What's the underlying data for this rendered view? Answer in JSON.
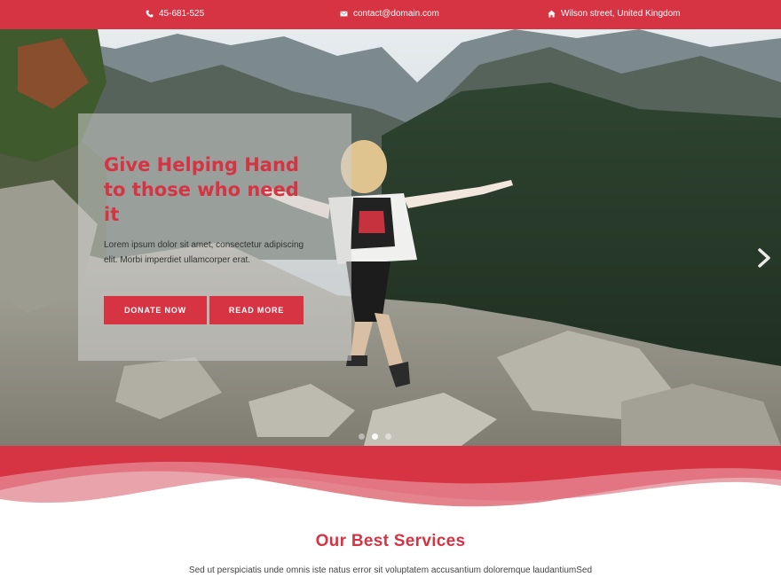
{
  "topbar": {
    "phone": "45-681-525",
    "email": "contact@domain.com",
    "address": "Wilson street, United Kingdom"
  },
  "hero": {
    "title": "Give Helping Hand to those who need it",
    "text": "Lorem ipsum dolor sit amet, consectetur adipiscing elit. Morbi imperdiet ullamcorper erat.",
    "donate_label": "DONATE NOW",
    "read_more_label": "READ MORE",
    "slide_count": 3,
    "active_slide": 2
  },
  "services": {
    "title": "Our Best Services",
    "text": "Sed ut perspiciatis unde omnis iste natus error sit voluptatem accusantium doloremque laudantiumSed"
  },
  "colors": {
    "accent": "#d63343"
  },
  "icons": {
    "phone": "phone-icon",
    "email": "envelope-icon",
    "address": "home-icon",
    "next": "chevron-right-icon"
  }
}
